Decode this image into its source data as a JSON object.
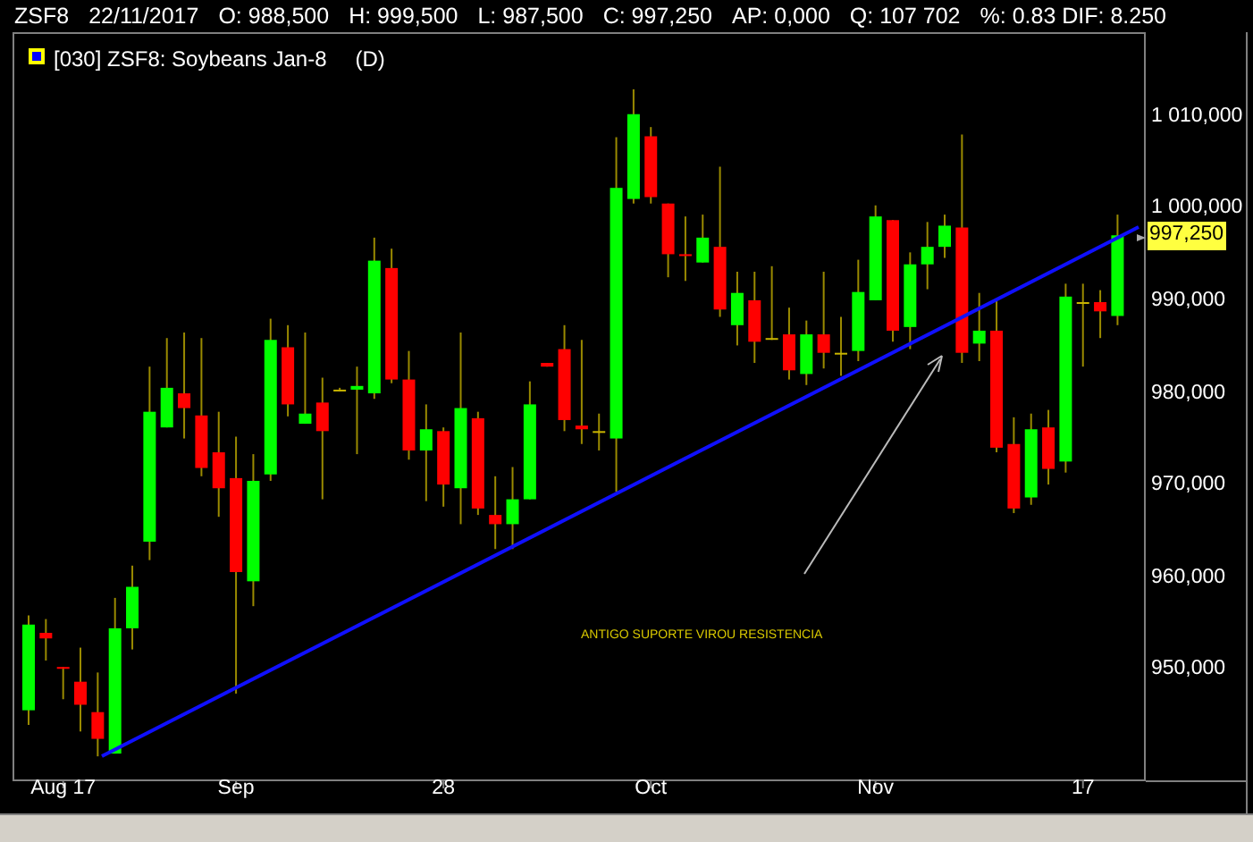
{
  "quote_bar": {
    "items": [
      "ZSF8",
      "22/11/2017",
      "O: 988,500",
      "H: 999,500",
      "L: 987,500",
      "C: 997,250",
      "AP: 0,000",
      "Q: 107 702",
      "%: 0.83 DIF: 8.250"
    ]
  },
  "legend": {
    "title": "[030] ZSF8: Soybeans Jan-8",
    "period": "(D)"
  },
  "chart": {
    "chart_data": {
      "type": "candlestick",
      "categories": [
        null,
        null,
        "Aug 17",
        null,
        null,
        null,
        null,
        null,
        null,
        null,
        null,
        null,
        "Sep",
        null,
        null,
        null,
        null,
        null,
        null,
        null,
        null,
        null,
        null,
        null,
        "28",
        null,
        null,
        null,
        null,
        null,
        null,
        null,
        null,
        null,
        null,
        null,
        "Oct",
        null,
        null,
        null,
        null,
        null,
        null,
        null,
        null,
        null,
        null,
        null,
        null,
        "Nov",
        null,
        null,
        null,
        null,
        null,
        null,
        null,
        null,
        null,
        null,
        null,
        "17",
        null,
        null
      ],
      "ohlc": [
        [
          945700,
          956000,
          944100,
          955000
        ],
        [
          954100,
          955600,
          951100,
          953500
        ],
        [
          950400,
          950400,
          946900,
          950200
        ],
        [
          948800,
          952500,
          943400,
          946300
        ],
        [
          945500,
          949800,
          940700,
          942600
        ],
        [
          941000,
          957900,
          941000,
          954600
        ],
        [
          954600,
          961400,
          952300,
          959100
        ],
        [
          964000,
          983000,
          962000,
          978100
        ],
        [
          976400,
          986100,
          976400,
          980700
        ],
        [
          980100,
          986700,
          975200,
          978500
        ],
        [
          977700,
          986100,
          971100,
          972000
        ],
        [
          973700,
          978100,
          966700,
          969800
        ],
        [
          970900,
          975400,
          947500,
          960700
        ],
        [
          959700,
          973500,
          957000,
          970600
        ],
        [
          971300,
          988200,
          970600,
          985900
        ],
        [
          985100,
          987500,
          977600,
          978900
        ],
        [
          976800,
          986700,
          976800,
          977900
        ],
        [
          979100,
          981800,
          968600,
          976000
        ],
        [
          980500,
          980700,
          980300,
          980500
        ],
        [
          980500,
          983000,
          973500,
          980900
        ],
        [
          980100,
          997000,
          979500,
          994500
        ],
        [
          993700,
          995800,
          981200,
          981600
        ],
        [
          981600,
          984700,
          972900,
          973900
        ],
        [
          973900,
          978900,
          968400,
          976200
        ],
        [
          976000,
          976400,
          967800,
          970200
        ],
        [
          969800,
          986700,
          965900,
          978500
        ],
        [
          977400,
          978100,
          966900,
          967600
        ],
        [
          966900,
          971100,
          963200,
          965900
        ],
        [
          965900,
          972100,
          963200,
          968600
        ],
        [
          968600,
          981400,
          968600,
          978900
        ],
        [
          983400,
          983400,
          983000,
          983000
        ],
        [
          984900,
          987500,
          976000,
          977200
        ],
        [
          976600,
          985900,
          974600,
          976200
        ],
        [
          976000,
          977900,
          973900,
          976000
        ],
        [
          975200,
          1007900,
          969400,
          1002400
        ],
        [
          1001200,
          1013100,
          1000700,
          1010400
        ],
        [
          1008000,
          1009000,
          1000700,
          1001400
        ],
        [
          1000700,
          1000700,
          992700,
          995200
        ],
        [
          995200,
          999300,
          992300,
          995000
        ],
        [
          994300,
          999500,
          994300,
          997000
        ],
        [
          996000,
          1004700,
          988400,
          989200
        ],
        [
          987500,
          993300,
          985300,
          991000
        ],
        [
          990200,
          993300,
          983400,
          985700
        ],
        [
          986100,
          993900,
          985900,
          986100
        ],
        [
          986500,
          989400,
          981600,
          982600
        ],
        [
          982200,
          988000,
          981000,
          986500
        ],
        [
          986500,
          993300,
          982800,
          984500
        ],
        [
          984500,
          988400,
          982000,
          984500
        ],
        [
          984700,
          994600,
          983600,
          991100
        ],
        [
          990200,
          1000500,
          990200,
          999300
        ],
        [
          998900,
          998900,
          985700,
          986900
        ],
        [
          987300,
          995400,
          984900,
          994100
        ],
        [
          994100,
          998700,
          991400,
          996000
        ],
        [
          996000,
          999500,
          994800,
          998300
        ],
        [
          998100,
          1008200,
          983400,
          984500
        ],
        [
          985500,
          991000,
          983600,
          986900
        ],
        [
          986900,
          990200,
          973700,
          974200
        ],
        [
          974600,
          977500,
          967100,
          967600
        ],
        [
          968800,
          977900,
          968000,
          976200
        ],
        [
          976400,
          978300,
          970200,
          971900
        ],
        [
          972700,
          992000,
          971500,
          990600
        ],
        [
          990000,
          992000,
          983000,
          990000
        ],
        [
          990000,
          991300,
          986100,
          989000
        ],
        [
          988500,
          999500,
          987500,
          997250
        ]
      ],
      "ylim": [
        938000,
        1019300
      ],
      "yticks": [
        {
          "value": 1010000,
          "label": "1 010,000"
        },
        {
          "value": 1000000,
          "label": "1 000,000"
        },
        {
          "value": 990000,
          "label": "990,000"
        },
        {
          "value": 980000,
          "label": "980,000"
        },
        {
          "value": 970000,
          "label": "970,000"
        },
        {
          "value": 960000,
          "label": "960,000"
        },
        {
          "value": 950000,
          "label": "950,000"
        }
      ]
    },
    "last_price": "997,250",
    "annotation": "ANTIGO SUPORTE VIROU RESISTENCIA"
  }
}
